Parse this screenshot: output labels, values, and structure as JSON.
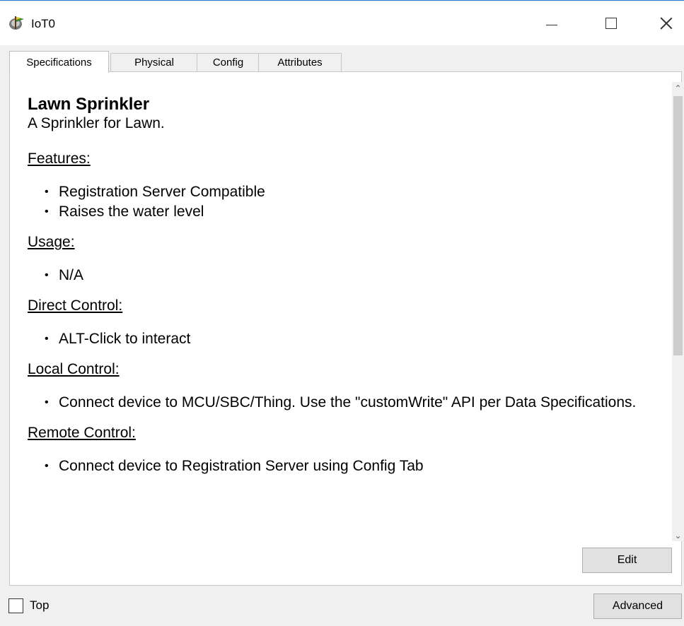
{
  "window": {
    "title": "IoT0",
    "icon": "lawn-sprinkler-device-icon",
    "controls": [
      "minimize-icon",
      "maximize-icon",
      "close-icon"
    ]
  },
  "tabs": [
    {
      "label": "Specifications",
      "active": true
    },
    {
      "label": "Physical",
      "active": false
    },
    {
      "label": "Config",
      "active": false
    },
    {
      "label": "Attributes",
      "active": false
    }
  ],
  "document": {
    "title": "Lawn Sprinkler",
    "subtitle": "A Sprinkler for Lawn.",
    "sections": [
      {
        "heading": "Features:",
        "items": [
          "Registration Server Compatible",
          "Raises the water level"
        ]
      },
      {
        "heading": "Usage:",
        "items": [
          "N/A"
        ]
      },
      {
        "heading": "Direct Control:",
        "items": [
          "ALT-Click to interact"
        ]
      },
      {
        "heading": "Local Control:",
        "items": [
          "Connect device to MCU/SBC/Thing. Use the \"customWrite\" API per Data Specifications."
        ]
      },
      {
        "heading": "Remote Control:",
        "items": [
          "Connect device to Registration Server using Config Tab"
        ]
      }
    ]
  },
  "buttons": {
    "edit": "Edit",
    "advanced": "Advanced"
  },
  "footer": {
    "top_label": "Top",
    "top_checked": false
  },
  "colors": {
    "accent": "#2b79d7",
    "panel_bg": "#ffffff",
    "window_bg": "#f0f0f0"
  }
}
